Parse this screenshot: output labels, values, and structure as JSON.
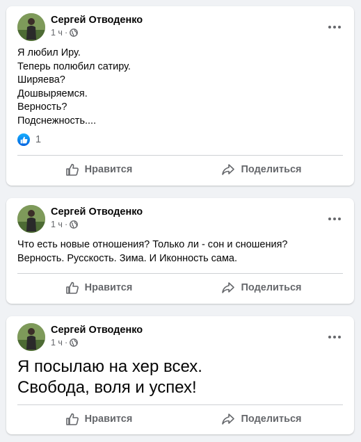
{
  "posts": [
    {
      "author": "Сергей Отводенко",
      "time": "1 ч",
      "dot": "·",
      "text": "Я любил Иру.\nТеперь полюбил сатиру.\nШиряева?\nДошвыряемся.\nВерность?\nПодснежность....",
      "reaction_count": "1",
      "like_label": "Нравится",
      "share_label": "Поделиться"
    },
    {
      "author": "Сергей Отводенко",
      "time": "1 ч",
      "dot": "·",
      "text": "Что есть новые отношения? Только ли - сон и сношения?\nВерность. Русскость. Зима. И Иконность сама.",
      "like_label": "Нравится",
      "share_label": "Поделиться"
    },
    {
      "author": "Сергей Отводенко",
      "time": "1 ч",
      "dot": "·",
      "text": "Я посылаю на хер всех.\nСвобода, воля и успех!",
      "like_label": "Нравится",
      "share_label": "Поделиться"
    }
  ],
  "icons": {
    "privacy": "globe-icon",
    "more": "more-dots-icon",
    "like": "thumbs-up-icon",
    "share": "share-arrow-icon",
    "reaction": "like-reaction-icon"
  },
  "colors": {
    "background": "#f0f2f5",
    "card": "#ffffff",
    "secondary_text": "#65676b",
    "like_blue": "#1877f2"
  }
}
